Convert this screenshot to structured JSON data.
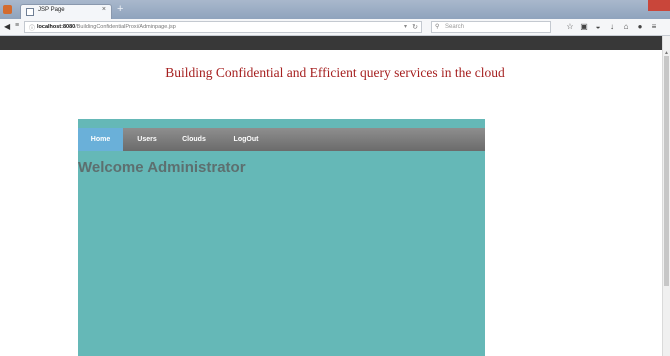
{
  "browser": {
    "tab_title": "JSP Page",
    "tab_close": "×",
    "new_tab": "+",
    "url_host": "localhost:8080",
    "url_path": "/BuildingConfidentialProxi/Adminpage.jsp",
    "search_placeholder": "Search"
  },
  "page": {
    "heading": "Building Confidential and Efficient query services in the cloud",
    "menu": [
      {
        "label": "Home",
        "active": true
      },
      {
        "label": "Users",
        "active": false
      },
      {
        "label": "Clouds",
        "active": false
      },
      {
        "label": "LogOut",
        "active": false
      }
    ],
    "welcome": "Welcome Administrator"
  },
  "colors": {
    "heading": "#a51f1f",
    "panel": "#65b8b7",
    "menu_bar": "#7d7d7d",
    "menu_active": "#6ab0d9",
    "welcome_text": "#5d6f6f"
  }
}
